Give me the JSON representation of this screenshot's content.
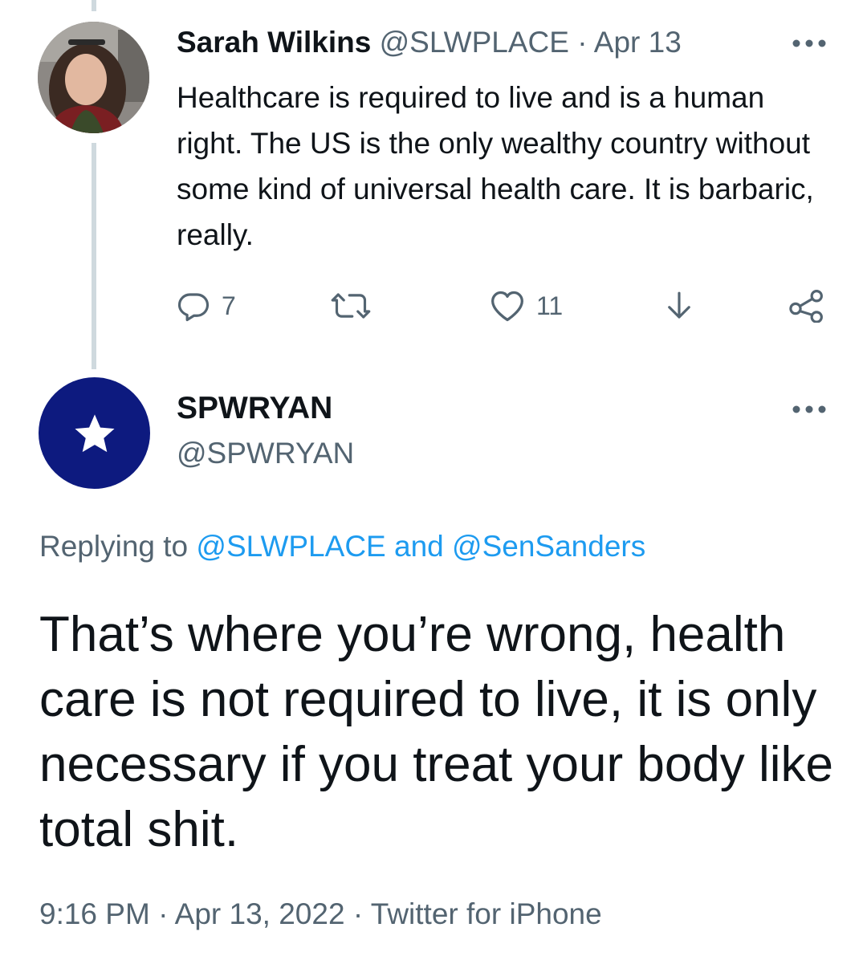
{
  "tweet1": {
    "avatar_icon": "profile-photo",
    "name": "Sarah Wilkins",
    "handle": "@SLWPLACE",
    "separator": "·",
    "date": "Apr 13",
    "text": "Healthcare is required to live and is a human right.  The US is the only wealthy country without some kind of universal health care.  It is barbaric, really.",
    "replies": "7",
    "likes": "11",
    "more_icon": "more-horizontal-icon"
  },
  "tweet2": {
    "avatar_icon": "star-icon",
    "avatar_color": "#0d1a7f",
    "name": "SPWRYAN",
    "handle": "@SPWRYAN",
    "replying_prefix": "Replying to",
    "reply_to_1": "@SLWPLACE",
    "reply_to_and": "and",
    "reply_to_2": "@SenSanders",
    "text": "That’s where you’re wrong, health care is not required to live, it is only necessary if you treat your body like total shit.",
    "time": "9:16 PM",
    "separator": "·",
    "date": "Apr 13, 2022",
    "source": "Twitter for iPhone"
  },
  "colors": {
    "link": "#1d9bf0",
    "muted": "#536471",
    "text": "#0f1419",
    "thread_line": "#cfd9de"
  }
}
